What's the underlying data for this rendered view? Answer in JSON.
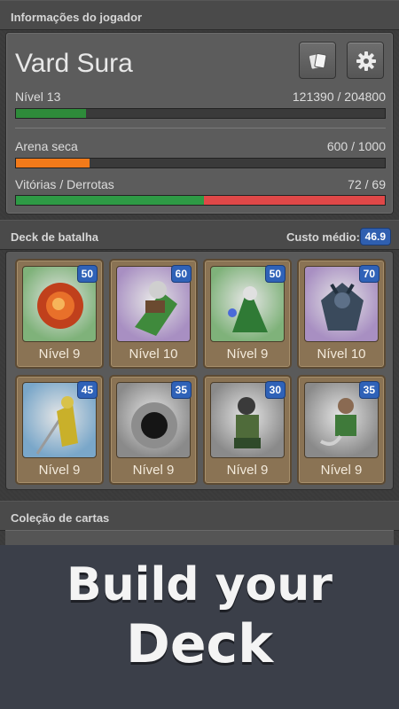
{
  "player_info": {
    "header": "Informações do jogador",
    "name": "Vard Sura",
    "level_label": "Nível 13",
    "xp_text": "121390 / 204800",
    "xp_progress": 0.19,
    "arena_label": "Arena seca",
    "arena_text": "600 / 1000",
    "arena_progress": 0.2,
    "wl_label": "Vitórias / Derrotas",
    "wl_text": "72 / 69",
    "wins": 72,
    "losses": 69
  },
  "deck": {
    "header": "Deck de batalha",
    "avg_cost_label": "Custo médio:",
    "avg_cost_value": "46.9",
    "cards": [
      {
        "cost": "50",
        "level": "Nível 9",
        "rarity_color": "#7fb27a",
        "icon": "fire-orb-icon"
      },
      {
        "cost": "60",
        "level": "Nível 10",
        "rarity_color": "#a88fc2",
        "icon": "wolf-rider-icon"
      },
      {
        "cost": "50",
        "level": "Nível 9",
        "rarity_color": "#7fb27a",
        "icon": "wizard-icon"
      },
      {
        "cost": "70",
        "level": "Nível 10",
        "rarity_color": "#a88fc2",
        "icon": "demon-icon"
      },
      {
        "cost": "45",
        "level": "Nível 9",
        "rarity_color": "#7aa7c9",
        "icon": "spearman-icon"
      },
      {
        "cost": "35",
        "level": "Nível 9",
        "rarity_color": "#8a8a8a",
        "icon": "stone-ring-icon"
      },
      {
        "cost": "30",
        "level": "Nível 9",
        "rarity_color": "#8a8a8a",
        "icon": "warrior-icon"
      },
      {
        "cost": "35",
        "level": "Nível 9",
        "rarity_color": "#8a8a8a",
        "icon": "swordsman-icon"
      }
    ]
  },
  "collection": {
    "header": "Coleção de cartas"
  },
  "banner": {
    "line1": "Build your",
    "line2": "Deck"
  },
  "colors": {
    "xp_bar": "#2e8b3a",
    "arena_bar": "#f27a1a",
    "wins_bar": "#2e9a45",
    "losses_bar": "#e04848",
    "badge_blue": "#2f62b8"
  }
}
